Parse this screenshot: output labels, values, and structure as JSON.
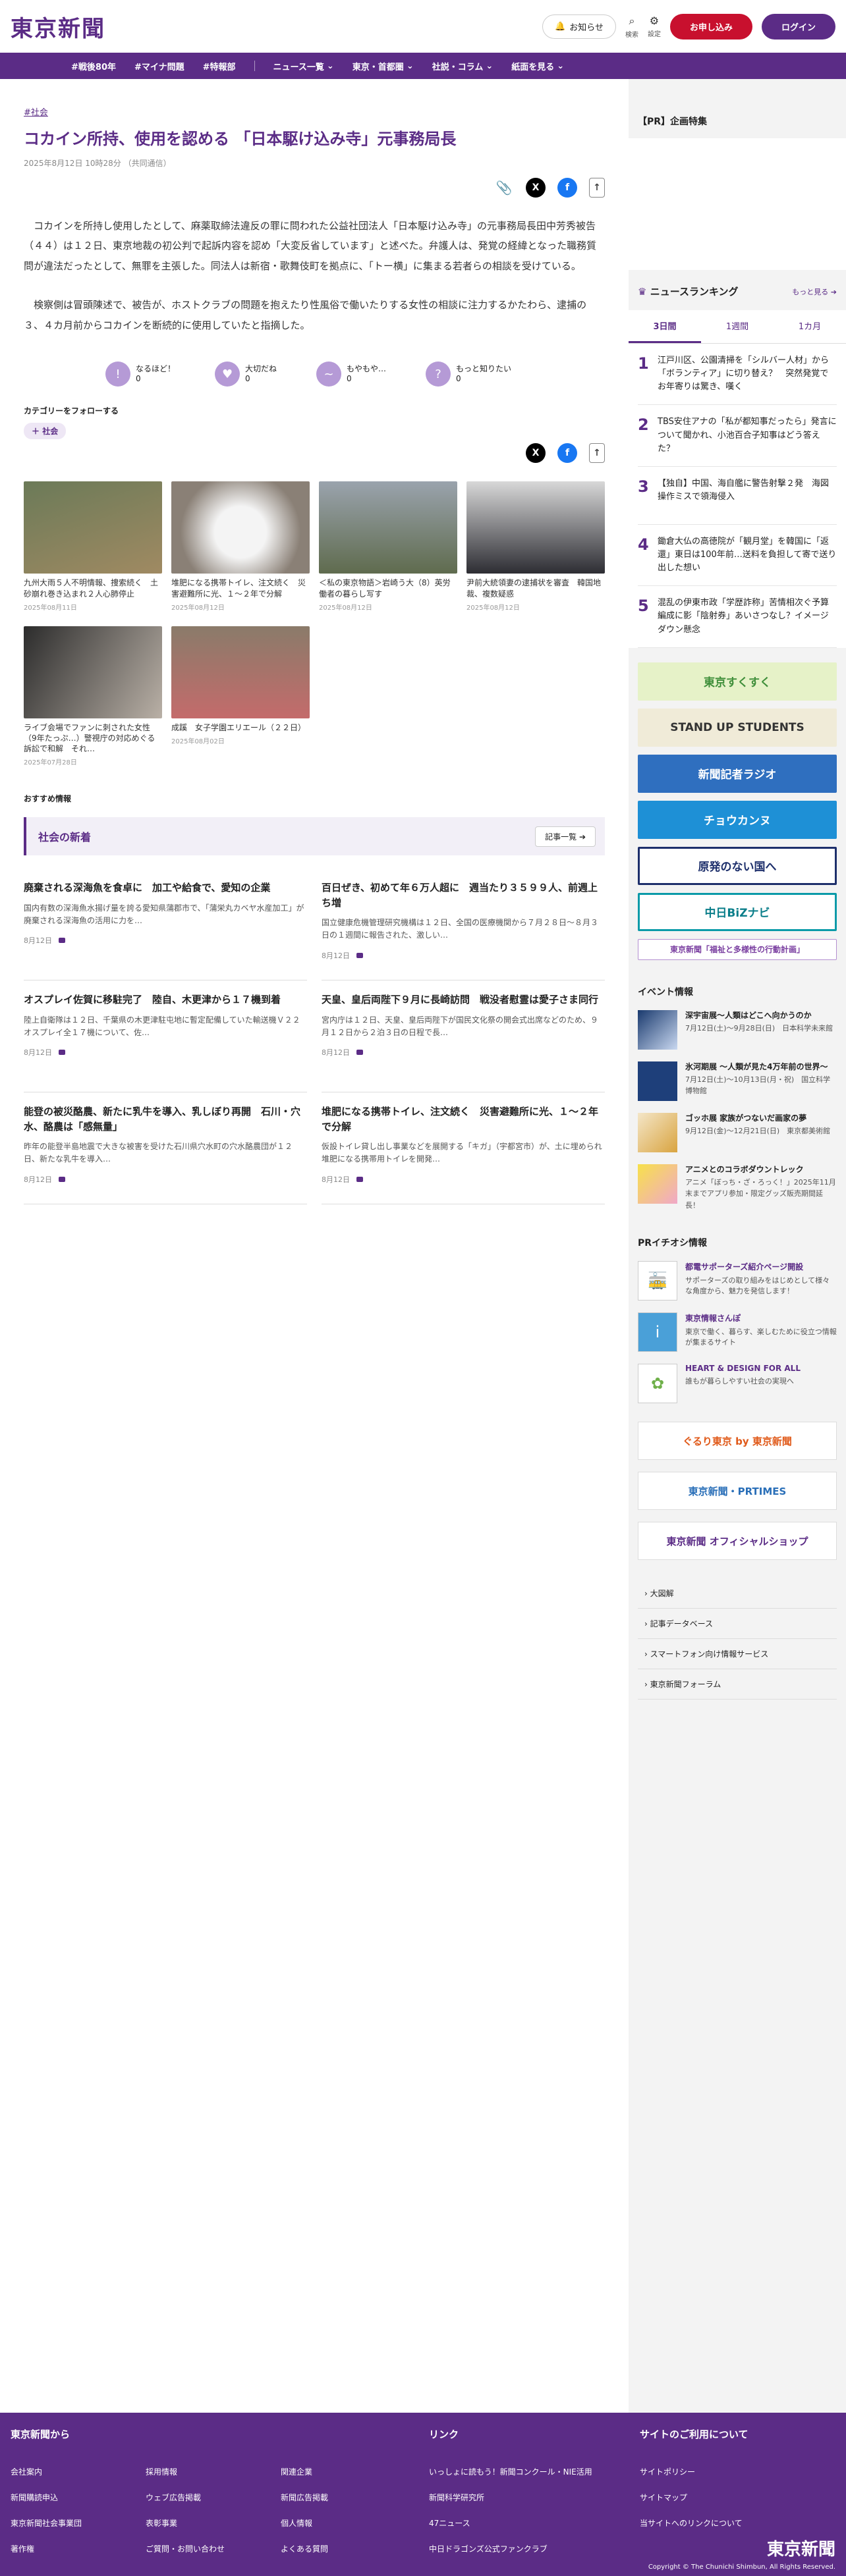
{
  "header": {
    "logo": "東京新聞",
    "notice": "お知らせ",
    "search": "検索",
    "settings": "設定",
    "subscribe": "お申し込み",
    "login": "ログイン"
  },
  "nav": [
    "#戦後80年",
    "#マイナ問題",
    "#特報部",
    "ニュース一覧",
    "東京・首都圏",
    "社説・コラム",
    "紙面を見る"
  ],
  "article": {
    "tag": "#社会",
    "title": "コカイン所持、使用を認める 「日本駆け込み寺」元事務局長",
    "date": "2025年8月12日 10時28分 （共同通信）",
    "paragraphs": [
      "コカインを所持し使用したとして、麻薬取締法違反の罪に問われた公益社団法人「日本駆け込み寺」の元事務局長田中芳秀被告（４４）は１２日、東京地裁の初公判で起訴内容を認め「大変反省しています」と述べた。弁護人は、発覚の経緯となった職務質問が違法だったとして、無罪を主張した。同法人は新宿・歌舞伎町を拠点に、「トー横」に集まる若者らの相談を受けている。",
      "検察側は冒頭陳述で、被告が、ホストクラブの問題を抱えたり性風俗で働いたりする女性の相談に注力するかたわら、逮捕の３、４カ月前からコカインを断続的に使用していたと指摘した。"
    ]
  },
  "reactions": [
    {
      "label": "なるほど！",
      "count": "0"
    },
    {
      "label": "大切だね",
      "count": "0"
    },
    {
      "label": "もやもや…",
      "count": "0"
    },
    {
      "label": "もっと知りたい",
      "count": "0"
    }
  ],
  "follow": {
    "label": "カテゴリーをフォローする",
    "chip": "社会"
  },
  "related": [
    {
      "title": "九州大雨５人不明情報、捜索続く　土砂崩れ巻き込まれ２人心肺停止",
      "date": "2025年08月11日"
    },
    {
      "title": "堆肥になる携帯トイレ、注文続く　災害避難所に光、１〜２年で分解",
      "date": "2025年08月12日"
    },
    {
      "title": "＜私の東京物語＞岩崎う大（8）英労働者の暮らし写す",
      "date": "2025年08月12日"
    },
    {
      "title": "尹前大統領妻の逮捕状を審査　韓国地裁、複数疑惑",
      "date": "2025年08月12日"
    },
    {
      "title": "ライブ会場でファンに刺された女性（9年たっぷ…）警視庁の対応めぐる訴訟で和解　それ…",
      "date": "2025年07月28日"
    },
    {
      "title": "成蹊　女子学園エリエール（２２日）",
      "date": "2025年08月02日"
    }
  ],
  "recommend": "おすすめ情報",
  "social_box": {
    "title": "社会の新着",
    "more": "記事一覧"
  },
  "news": [
    {
      "title": "廃棄される深海魚を食卓に　加工や給食で、愛知の企業",
      "body": "国内有数の深海魚水揚げ量を誇る愛知県蒲郡市で、「蒲栄丸カベヤ水産加工」が廃棄される深海魚の活用に力を…",
      "date": "8月12日"
    },
    {
      "title": "百日ぜき、初めて年６万人超に　週当たり３５９９人、前週上ち増",
      "body": "国立健康危機管理研究機構は１２日、全国の医療機関から７月２８日〜８月３日の１週間に報告された、激しい…",
      "date": "8月12日"
    },
    {
      "title": "オスプレイ佐賀に移駐完了　陸自、木更津から１７機到着",
      "body": "陸上自衛隊は１２日、千葉県の木更津駐屯地に暫定配備していた輸送機Ｖ２２オスプレイ全１７機について、佐…",
      "date": "8月12日"
    },
    {
      "title": "天皇、皇后両陛下９月に長崎訪問　戦没者慰霊は愛子さま同行",
      "body": "宮内庁は１２日、天皇、皇后両陛下が国民文化祭の開会式出席などのため、９月１２日から２泊３日の日程で長…",
      "date": "8月12日"
    },
    {
      "title": "能登の被災酪農、新たに乳牛を導入、乳しぼり再開　石川・穴水、酪農は「感無量」",
      "body": "昨年の能登半島地震で大きな被害を受けた石川県穴水町の穴水酪農団が１２日、新たな乳牛を導入…",
      "date": "8月12日"
    },
    {
      "title": "堆肥になる携帯トイレ、注文続く　災害避難所に光、１〜２年で分解",
      "body": "仮設トイレ貸し出し事業などを展開する「キガ」（宇都宮市）が、土に埋められ堆肥になる携帯用トイレを開発…",
      "date": "8月12日"
    }
  ],
  "sidebar": {
    "pr_title": "【PR】企画特集",
    "ranking_title": "ニュースランキング",
    "ranking_more": "もっと見る",
    "tabs": [
      "3日間",
      "1週間",
      "1カ月"
    ],
    "ranks": [
      {
        "n": "1",
        "t": "江戸川区、公園清掃を「シルバー人材」から「ボランティア」に切り替え？　突然発覚でお年寄りは驚き、嘆く"
      },
      {
        "n": "2",
        "t": "TBS安住アナの「私が都知事だったら」発言について聞かれ、小池百合子知事はどう答えた？"
      },
      {
        "n": "3",
        "t": "【独自】中国、海自艦に警告射撃２発　海図操作ミスで領海侵入"
      },
      {
        "n": "4",
        "t": "鋤倉大仏の高徳院が「観月堂」を韓国に「返還」東日は100年前…送料を負担して寄で送り出した想い"
      },
      {
        "n": "5",
        "t": "混乱の伊東市政「学歴詐称」苦情相次ぐ予算編成に影「陰射券」あいさつなし？イメージダウン懸念"
      }
    ],
    "banners": [
      "東京すくすく",
      "STAND UP STUDENTS",
      "新聞記者ラジオ",
      "チョウカンヌ",
      "原発のない国へ",
      "中日BiZナビ",
      "東京新聞「福祉と多様性の行動計画」"
    ],
    "event_title": "イベント情報",
    "events": [
      {
        "title": "深宇宙展〜人類はどこへ向かうのか",
        "desc": "7月12日(土)〜9月28日(日)　日本科学未来館"
      },
      {
        "title": "氷河期展 〜人類が見た4万年前の世界〜",
        "desc": "7月12日(土)〜10月13日(月・祝)　国立科学博物館"
      },
      {
        "title": "ゴッホ展 家族がつないだ画家の夢",
        "desc": "9月12日(金)〜12月21日(日)　東京都美術館"
      },
      {
        "title": "アニメとのコラボダウントレック",
        "desc": "アニメ「ぼっち・ざ・ろっく！」2025年11月末までアプリ参加・限定グッズ販売期間延長！"
      }
    ],
    "pr2_title": "PRイチオシ情報",
    "pr2": [
      {
        "title": "都電サポーターズ紹介ページ開設",
        "desc": "サポーターズの取り組みをはじめとして様々な角度から、魅力を発信します！"
      },
      {
        "title": "東京情報さんぽ",
        "desc": "東京で働く、暮らす、楽しむために役立つ情報が集まるサイト"
      },
      {
        "title": "HEART & DESIGN FOR ALL",
        "desc": "誰もが暮らしやすい社会の実現へ"
      }
    ],
    "wbanners": [
      "ぐるり東京 by 東京新聞",
      "東京新聞・PRTIMES",
      "東京新聞 オフィシャルショップ"
    ],
    "links": [
      "大図解",
      "記事データベース",
      "スマートフォン向け情報サービス",
      "東京新聞フォーラム"
    ]
  },
  "footer": {
    "col1_title": "東京新聞から",
    "col1": [
      "会社案内",
      "採用情報",
      "関連企業",
      "新聞購読申込",
      "ウェブ広告掲載",
      "新聞広告掲載",
      "東京新聞社会事業団",
      "表彰事業",
      "個人情報",
      "著作権",
      "ご質問・お問い合わせ",
      "よくある質問"
    ],
    "col2_title": "リンク",
    "col2": [
      "いっしょに読もう！新聞コンクール・NIE活用",
      "新聞科学研究所",
      "47ニュース",
      "中日ドラゴンズ公式ファンクラブ"
    ],
    "col3_title": "サイトのご利用について",
    "col3": [
      "サイトポリシー",
      "サイトマップ",
      "当サイトへのリンクについて"
    ],
    "logo": "東京新聞",
    "copyright": "Copyright © The Chunichi Shimbun, All Rights Reserved."
  }
}
